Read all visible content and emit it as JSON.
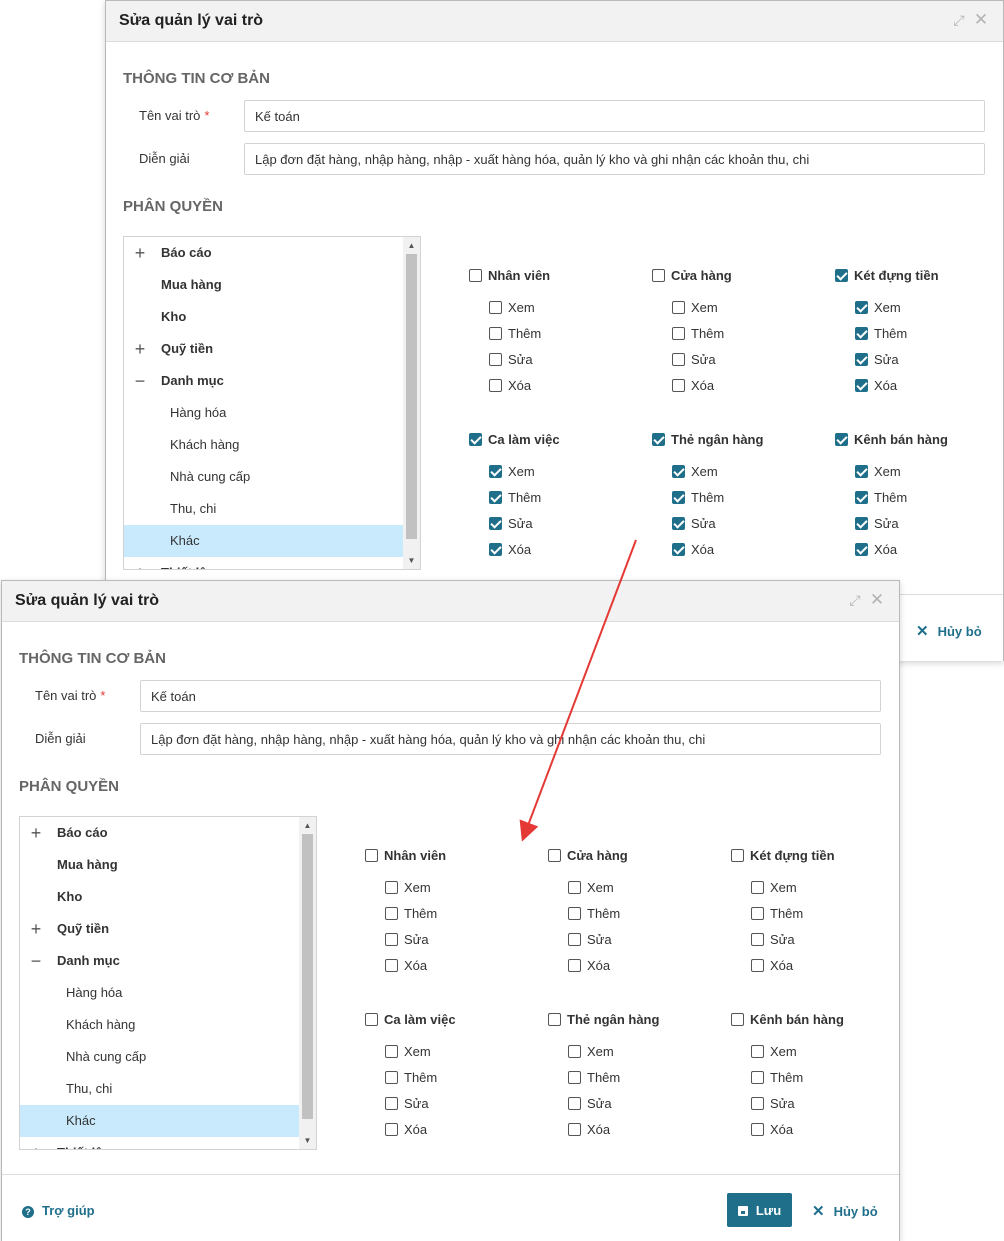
{
  "dialog": {
    "title": "Sửa quản lý vai trò",
    "basic_info_title": "THÔNG TIN CƠ BẢN",
    "role_name_label": "Tên vai trò",
    "required_mark": "*",
    "role_name_value": "Kế toán",
    "description_label": "Diễn giải",
    "description_value": "Lập đơn đặt hàng, nhập hàng, nhập - xuất hàng hóa, quản lý kho và ghi nhận các khoản thu, chi",
    "permission_title": "PHÂN QUYỀN",
    "help_label": "Trợ giúp",
    "save_label": "Lưu",
    "cancel_label": "Hủy bỏ"
  },
  "tree": {
    "items": [
      {
        "label": "Báo cáo",
        "toggle": "+"
      },
      {
        "label": "Mua hàng",
        "toggle": ""
      },
      {
        "label": "Kho",
        "toggle": ""
      },
      {
        "label": "Quỹ tiền",
        "toggle": "+"
      },
      {
        "label": "Danh mục",
        "toggle": "−"
      },
      {
        "label": "Hàng hóa"
      },
      {
        "label": "Khách hàng"
      },
      {
        "label": "Nhà cung cấp"
      },
      {
        "label": "Thu, chi"
      },
      {
        "label": "Khác",
        "selected": true
      },
      {
        "label": "Thiết lập",
        "toggle": "+"
      }
    ]
  },
  "perm_actions": [
    "Xem",
    "Thêm",
    "Sửa",
    "Xóa"
  ],
  "before": {
    "groups": [
      {
        "name": "Nhân viên",
        "checked": false,
        "actions": [
          false,
          false,
          false,
          false
        ]
      },
      {
        "name": "Cửa hàng",
        "checked": false,
        "actions": [
          false,
          false,
          false,
          false
        ]
      },
      {
        "name": "Két đựng tiền",
        "checked": true,
        "actions": [
          true,
          true,
          true,
          true
        ]
      },
      {
        "name": "Ca làm việc",
        "checked": true,
        "actions": [
          true,
          true,
          true,
          true
        ]
      },
      {
        "name": "Thẻ ngân hàng",
        "checked": true,
        "actions": [
          true,
          true,
          true,
          true
        ]
      },
      {
        "name": "Kênh bán hàng",
        "checked": true,
        "actions": [
          true,
          true,
          true,
          true
        ]
      }
    ]
  },
  "after": {
    "groups": [
      {
        "name": "Nhân viên",
        "checked": false,
        "actions": [
          false,
          false,
          false,
          false
        ]
      },
      {
        "name": "Cửa hàng",
        "checked": false,
        "actions": [
          false,
          false,
          false,
          false
        ]
      },
      {
        "name": "Két đựng tiền",
        "checked": false,
        "actions": [
          false,
          false,
          false,
          false
        ]
      },
      {
        "name": "Ca làm việc",
        "checked": false,
        "actions": [
          false,
          false,
          false,
          false
        ]
      },
      {
        "name": "Thẻ ngân hàng",
        "checked": false,
        "actions": [
          false,
          false,
          false,
          false
        ]
      },
      {
        "name": "Kênh bán hàng",
        "checked": false,
        "actions": [
          false,
          false,
          false,
          false
        ]
      }
    ]
  },
  "colors": {
    "accent": "#1f6f8b",
    "selected_row": "#c8eafc",
    "required": "#e53935",
    "arrow": "#e53935"
  },
  "icons": {
    "expand": "expand-icon",
    "close": "close-icon",
    "help": "question-circle-icon",
    "save": "floppy-disk-icon",
    "cancel": "x-icon"
  }
}
